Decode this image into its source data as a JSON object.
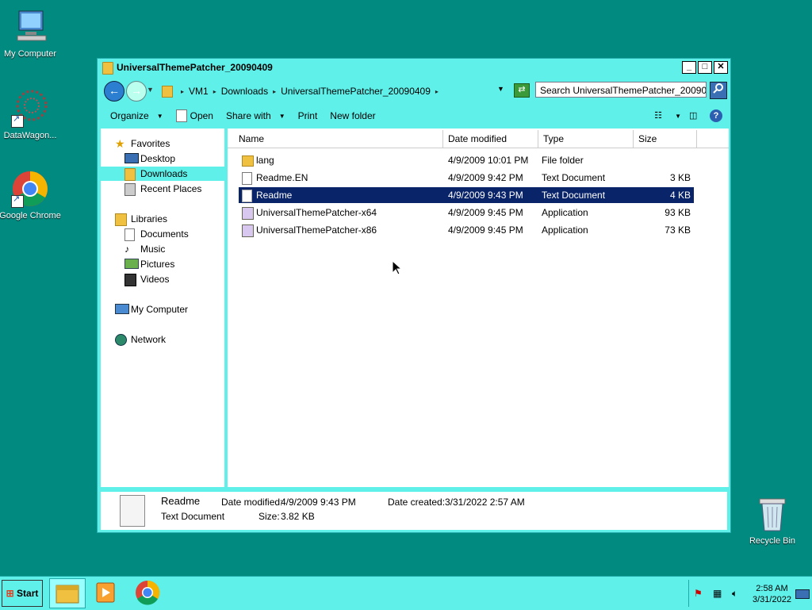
{
  "desktop": {
    "icons": [
      {
        "label": "My Computer"
      },
      {
        "label": "DataWagon..."
      },
      {
        "label": "Google Chrome"
      }
    ],
    "recycle_bin": "Recycle Bin"
  },
  "window": {
    "title": "UniversalThemePatcher_20090409",
    "controls": {
      "minimize": "_",
      "maximize": "□",
      "close": "✕"
    },
    "breadcrumbs": [
      "VM1",
      "Downloads",
      "UniversalThemePatcher_20090409"
    ],
    "search_placeholder": "Search UniversalThemePatcher_20090...",
    "toolbar": {
      "organize": "Organize",
      "open": "Open",
      "share_with": "Share with",
      "print": "Print",
      "new_folder": "New folder"
    },
    "nav": {
      "favorites": "Favorites",
      "desktop": "Desktop",
      "downloads": "Downloads",
      "recent_places": "Recent Places",
      "libraries": "Libraries",
      "documents": "Documents",
      "music": "Music",
      "pictures": "Pictures",
      "videos": "Videos",
      "my_computer": "My Computer",
      "network": "Network"
    },
    "columns": {
      "name": "Name",
      "date_modified": "Date modified",
      "type": "Type",
      "size": "Size"
    },
    "files": [
      {
        "name": "lang",
        "date": "4/9/2009 10:01 PM",
        "type": "File folder",
        "size": ""
      },
      {
        "name": "Readme.EN",
        "date": "4/9/2009 9:42 PM",
        "type": "Text Document",
        "size": "3 KB"
      },
      {
        "name": "Readme",
        "date": "4/9/2009 9:43 PM",
        "type": "Text Document",
        "size": "4 KB"
      },
      {
        "name": "UniversalThemePatcher-x64",
        "date": "4/9/2009 9:45 PM",
        "type": "Application",
        "size": "93 KB"
      },
      {
        "name": "UniversalThemePatcher-x86",
        "date": "4/9/2009 9:45 PM",
        "type": "Application",
        "size": "73 KB"
      }
    ],
    "details": {
      "name": "Readme",
      "type": "Text Document",
      "date_modified_label": "Date modified:",
      "date_modified": "4/9/2009 9:43 PM",
      "size_label": "Size:",
      "size": "3.82 KB",
      "date_created_label": "Date created:",
      "date_created": "3/31/2022 2:57 AM"
    }
  },
  "taskbar": {
    "start": "Start",
    "time": "2:58 AM",
    "date": "3/31/2022"
  },
  "colors": {
    "window_bg": "#5ff0ea",
    "desktop": "#008a80",
    "selection": "#0a246a"
  }
}
